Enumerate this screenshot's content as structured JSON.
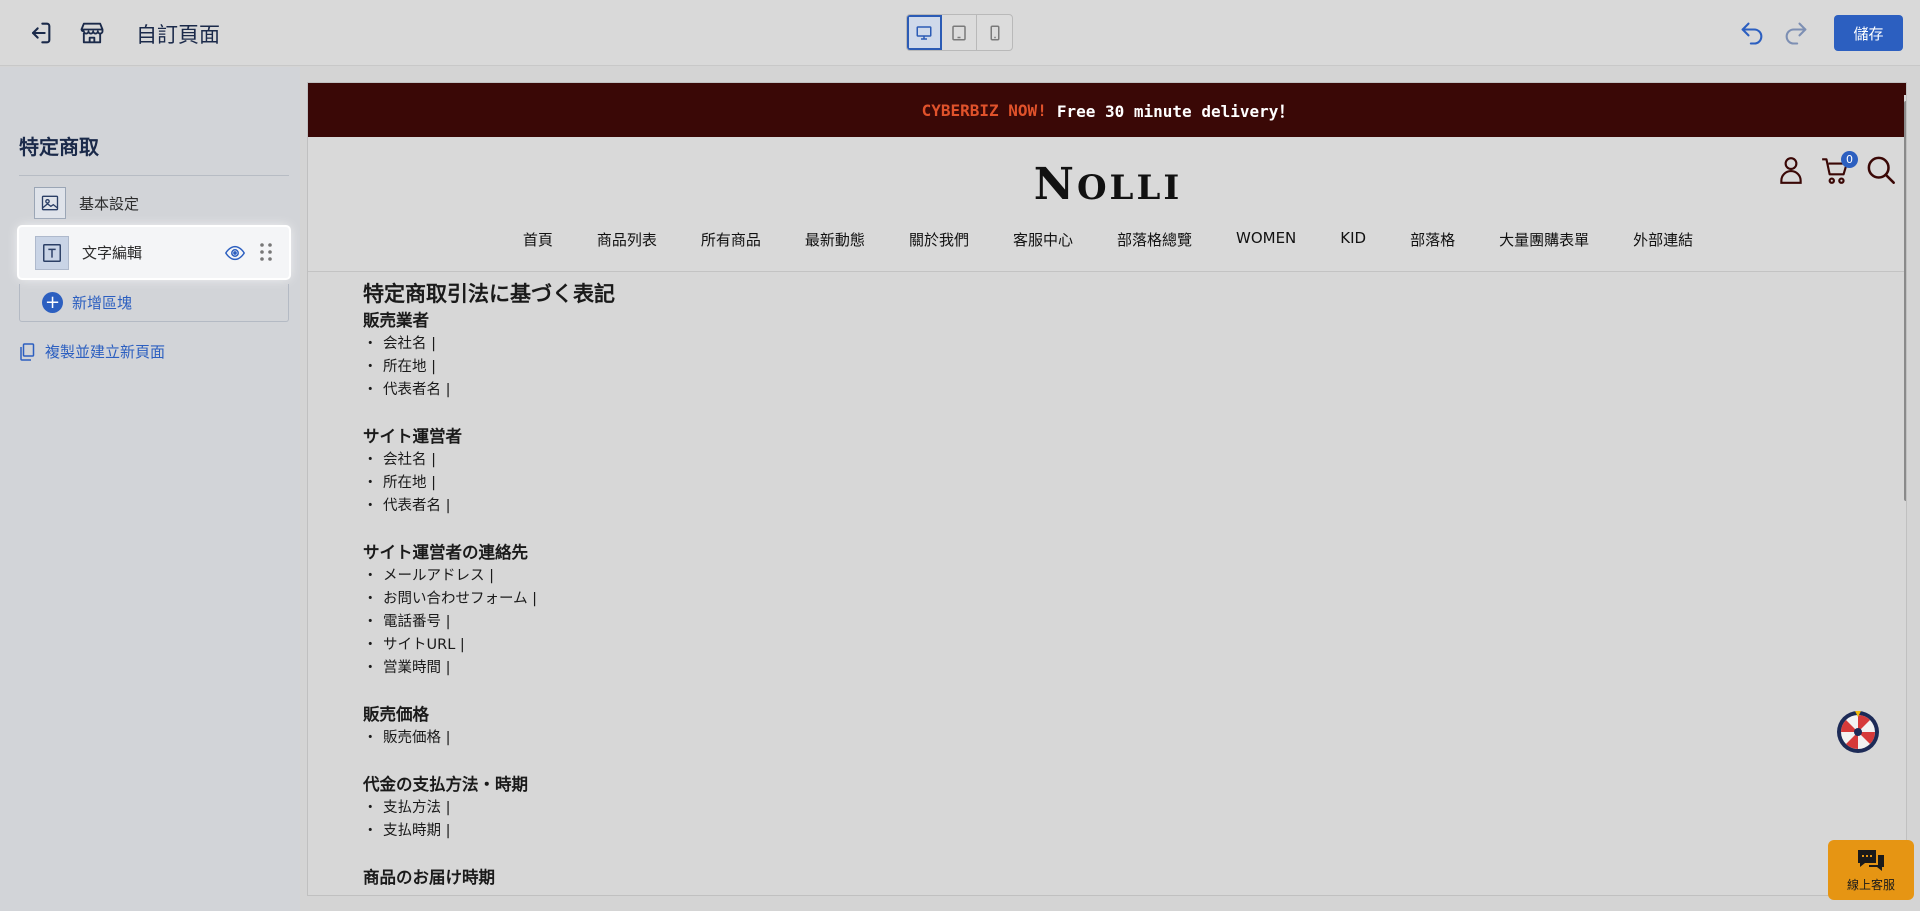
{
  "toolbar": {
    "page_title": "自訂頁面",
    "save_label": "儲存"
  },
  "sidebar": {
    "title": "特定商取",
    "basic_settings": "基本設定",
    "text_editor": "文字編輯",
    "add_block": "新增區塊",
    "copy_page": "複製並建立新頁面"
  },
  "preview": {
    "announcement_brand": "CYBERBIZ NOW!",
    "announcement_text": "Free 30 minute delivery！",
    "logo_first": "N",
    "logo_rest": "OLLI",
    "cart_count": "0",
    "nav": [
      "首頁",
      "商品列表",
      "所有商品",
      "最新動態",
      "關於我們",
      "客服中心",
      "部落格總覽",
      "WOMEN",
      "KID",
      "部落格",
      "大量團購表單",
      "外部連結"
    ],
    "page_heading": "特定商取引法に基づく表記",
    "sections": [
      {
        "title": "販売業者",
        "items": [
          "会社名 |",
          "所在地 |",
          "代表者名 |"
        ]
      },
      {
        "title": "サイト運営者",
        "items": [
          "会社名 |",
          "所在地 |",
          "代表者名 |"
        ]
      },
      {
        "title": "サイト運営者の連絡先",
        "items": [
          "メールアドレス |",
          "お問い合わせフォーム |",
          "電話番号 |",
          "サイトURL |",
          "営業時間 |"
        ]
      },
      {
        "title": "販売価格",
        "items": [
          "販売価格 |"
        ]
      },
      {
        "title": "代金の支払方法・時期",
        "items": [
          "支払方法 |",
          "支払時期 |"
        ]
      },
      {
        "title": "商品のお届け時期",
        "items": []
      }
    ],
    "chat_label": "線上客服"
  },
  "colors": {
    "accent": "#2c5fc0",
    "announcement_bg": "#3a0806",
    "announcement_brand": "#e0522b",
    "chat_bg": "#e69513"
  }
}
